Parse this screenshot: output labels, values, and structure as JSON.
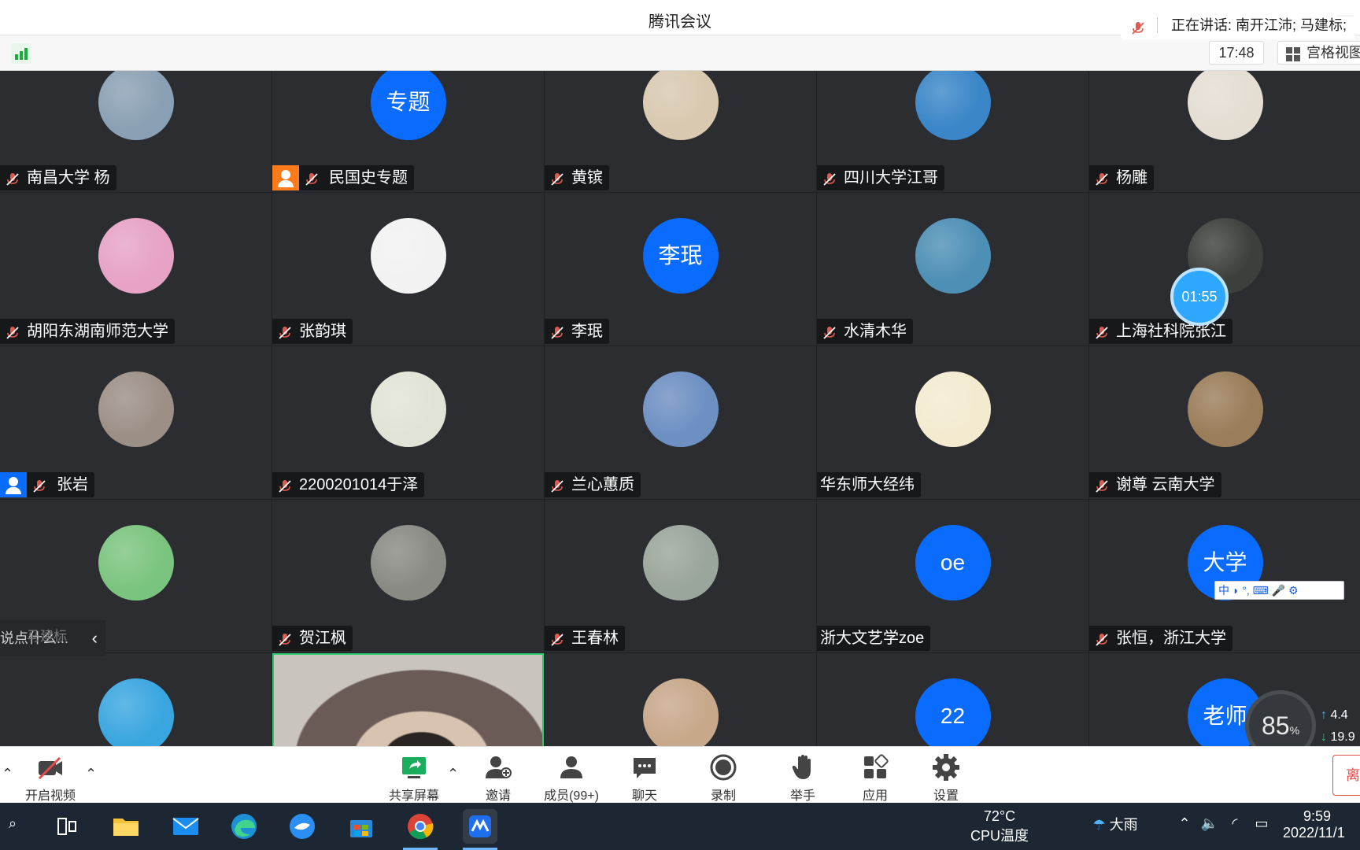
{
  "window": {
    "title": "腾讯会议"
  },
  "topbar": {
    "time": "17:48",
    "view_label": "宫格视图"
  },
  "speaking": {
    "label": "正在讲话: 南开江沛; 马建标;"
  },
  "timer": {
    "value": "01:55"
  },
  "chat": {
    "placeholder": "说点什么...",
    "ghost_name": "马建标"
  },
  "ime": {
    "label": "中 ◗ °, ⌨ 🎤 ⚙"
  },
  "speed": {
    "percent": "85",
    "percent_unit": "%",
    "up": "4.4",
    "down": "19.9"
  },
  "participants": [
    {
      "name": "南昌大学 杨",
      "avatar": "photo",
      "color": "#8aa0b4",
      "mic": true
    },
    {
      "name": "民国史专题",
      "avatar": "text",
      "avatar_text": "专题",
      "mic": true,
      "host": "orange"
    },
    {
      "name": "黄镔",
      "avatar": "photo",
      "color": "#d8c9b0",
      "mic": true
    },
    {
      "name": "四川大学江哥",
      "avatar": "photo",
      "color": "#3a86c8",
      "mic": true
    },
    {
      "name": "杨雕",
      "avatar": "photo",
      "color": "#e4ddd2",
      "mic": true
    },
    {
      "name": "胡阳东湖南师范大学",
      "avatar": "photo",
      "color": "#e6a3c5",
      "mic": true
    },
    {
      "name": "张韵琪",
      "avatar": "photo",
      "color": "#f2f2f2",
      "mic": true
    },
    {
      "name": "李珉",
      "avatar": "text",
      "avatar_text": "李珉",
      "mic": true
    },
    {
      "name": "水清木华",
      "avatar": "photo",
      "color": "#4e8fb5",
      "mic": true
    },
    {
      "name": "上海社科院张江",
      "avatar": "photo",
      "color": "#3d3f3c",
      "mic": true
    },
    {
      "name": "张岩",
      "avatar": "photo",
      "color": "#9c8f86",
      "mic": true,
      "host": "blue"
    },
    {
      "name": "2200201014于泽",
      "avatar": "photo",
      "color": "#e1e3d6",
      "mic": true
    },
    {
      "name": "兰心蕙质",
      "avatar": "photo",
      "color": "#6d8fc2",
      "mic": true
    },
    {
      "name": "华东师大经纬",
      "avatar": "photo",
      "color": "#f3ead0",
      "mic": false
    },
    {
      "name": "谢尊 云南大学",
      "avatar": "photo",
      "color": "#9a7d5a",
      "mic": true
    },
    {
      "name": "",
      "avatar": "photo",
      "color": "#7bc47f",
      "mic": false
    },
    {
      "name": "贺江枫",
      "avatar": "photo",
      "color": "#8a8a84",
      "mic": true
    },
    {
      "name": "王春林",
      "avatar": "photo",
      "color": "#9aa59b",
      "mic": true
    },
    {
      "name": "浙大文艺学zoe",
      "avatar": "text",
      "avatar_text": "oe",
      "mic": false
    },
    {
      "name": "张恒，浙江大学",
      "avatar": "text",
      "avatar_text": "大学",
      "mic": true
    },
    {
      "name": "",
      "avatar": "photo",
      "color": "#3aa6e0",
      "mic": false
    },
    {
      "name": "",
      "avatar": "video",
      "color": "#6b5b57",
      "mic": false
    },
    {
      "name": "",
      "avatar": "photo",
      "color": "#c7a88a",
      "mic": false
    },
    {
      "name": "",
      "avatar": "text",
      "avatar_text": "22",
      "mic": false
    },
    {
      "name": "",
      "avatar": "text",
      "avatar_text": "老师",
      "mic": false
    }
  ],
  "toolbar": {
    "video": "开启视频",
    "share": "共享屏幕",
    "invite": "邀请",
    "members": "成员(99+)",
    "chat": "聊天",
    "record": "录制",
    "raise_hand": "举手",
    "apps": "应用",
    "settings": "设置",
    "leave": "离"
  },
  "taskbar": {
    "cpu_temp": "72°C",
    "cpu_label": "CPU温度",
    "weather": "大雨",
    "time": "9:59",
    "date": "2022/11/1"
  },
  "colors": {
    "accent": "#0a6cff",
    "tile_bg": "#2b2d31",
    "host_orange": "#ff7a1a"
  }
}
